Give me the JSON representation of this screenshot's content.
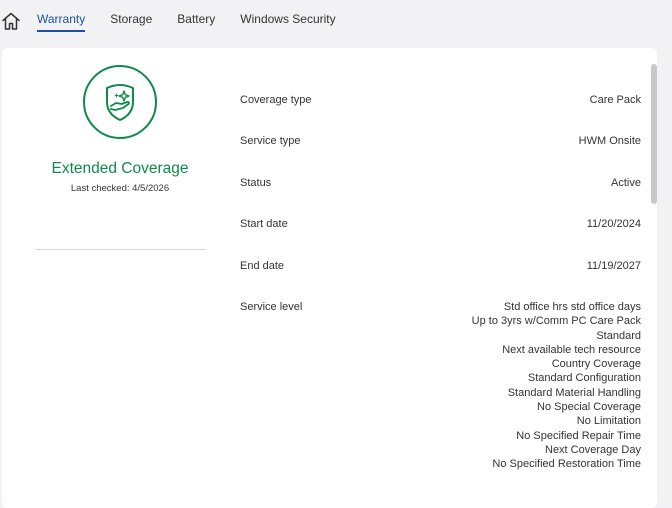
{
  "header": {
    "home_icon": "home-icon",
    "tabs": [
      {
        "label": "Warranty",
        "active": true
      },
      {
        "label": "Storage",
        "active": false
      },
      {
        "label": "Battery",
        "active": false
      },
      {
        "label": "Windows Security",
        "active": false
      }
    ]
  },
  "colors": {
    "accent_green": "#0e8a4a",
    "tab_active": "#1f4fa0",
    "background": "#f2f2f4",
    "card": "#ffffff"
  },
  "summary": {
    "badge_icon": "shield-hand-sparkle-icon",
    "title": "Extended Coverage",
    "last_checked": "Last checked: 4/5/2026"
  },
  "details": {
    "coverage_type": {
      "label": "Coverage type",
      "value": "Care Pack"
    },
    "service_type": {
      "label": "Service type",
      "value": "HWM Onsite"
    },
    "status": {
      "label": "Status",
      "value": "Active"
    },
    "start_date": {
      "label": "Start date",
      "value": "11/20/2024"
    },
    "end_date": {
      "label": "End date",
      "value": "11/19/2027"
    },
    "service_level": {
      "label": "Service level",
      "values": [
        "Std office hrs std office days",
        "Up to 3yrs w/Comm PC Care Pack",
        "Standard",
        "Next available tech resource",
        "Country Coverage",
        "Standard Configuration",
        "Standard Material Handling",
        "No Special Coverage",
        "No Limitation",
        "No Specified Repair Time",
        "Next Coverage Day",
        "No Specified Restoration Time"
      ]
    }
  }
}
